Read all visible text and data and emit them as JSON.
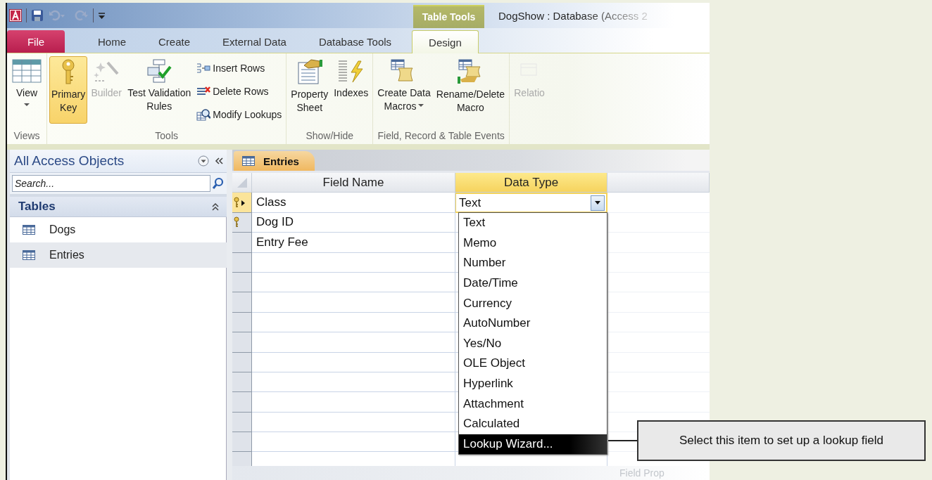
{
  "window": {
    "title": "DogShow : Database (Access 2"
  },
  "contextual_tab": {
    "label": "Table Tools"
  },
  "tabs": [
    {
      "label": "File",
      "kind": "backstage",
      "selected": false
    },
    {
      "label": "Home",
      "kind": "normal",
      "selected": false
    },
    {
      "label": "Create",
      "kind": "normal",
      "selected": false
    },
    {
      "label": "External Data",
      "kind": "normal",
      "selected": false
    },
    {
      "label": "Database Tools",
      "kind": "normal",
      "selected": false
    },
    {
      "label": "Design",
      "kind": "contextual",
      "selected": true
    }
  ],
  "ribbon": {
    "groups": [
      {
        "label": "Views",
        "commands": [
          {
            "label": "View",
            "kind": "large",
            "dropdown": true,
            "selected": false,
            "disabled": false
          }
        ]
      },
      {
        "label": "Tools",
        "commands": [
          {
            "label": "Primary\nKey",
            "kind": "large",
            "dropdown": false,
            "selected": true,
            "disabled": false
          },
          {
            "label": "Builder",
            "kind": "large",
            "dropdown": false,
            "selected": false,
            "disabled": true
          },
          {
            "label": "Test Validation\nRules",
            "kind": "large",
            "dropdown": false,
            "selected": false,
            "disabled": false
          },
          {
            "label": "Insert Rows",
            "kind": "small",
            "disabled": false
          },
          {
            "label": "Delete Rows",
            "kind": "small",
            "disabled": false
          },
          {
            "label": "Modify Lookups",
            "kind": "small",
            "disabled": false
          }
        ]
      },
      {
        "label": "Show/Hide",
        "commands": [
          {
            "label": "Property\nSheet",
            "kind": "large",
            "dropdown": false,
            "selected": false,
            "disabled": false
          },
          {
            "label": "Indexes",
            "kind": "large",
            "dropdown": false,
            "selected": false,
            "disabled": false
          }
        ]
      },
      {
        "label": "Field, Record & Table Events",
        "commands": [
          {
            "label": "Create Data\nMacros",
            "kind": "large",
            "dropdown": true,
            "selected": false,
            "disabled": false
          },
          {
            "label": "Rename/Delete\nMacro",
            "kind": "large",
            "dropdown": false,
            "selected": false,
            "disabled": false
          }
        ]
      },
      {
        "commands": [
          {
            "label": "Relatio",
            "kind": "large",
            "dropdown": false,
            "selected": false,
            "disabled": true
          }
        ]
      }
    ]
  },
  "navigation_pane": {
    "title": "All Access Objects",
    "search": {
      "placeholder": "Search..."
    },
    "sections": [
      {
        "label": "Tables",
        "expanded": true,
        "items": [
          {
            "label": "Dogs",
            "selected": false
          },
          {
            "label": "Entries",
            "selected": true
          }
        ]
      }
    ]
  },
  "document_tabs": [
    {
      "label": "Entries",
      "selected": true
    }
  ],
  "design_grid": {
    "columns": [
      {
        "label": "Field Name",
        "selected": false
      },
      {
        "label": "Data Type",
        "selected": true
      }
    ],
    "rows": [
      {
        "field_name": "Class",
        "data_type": "Text",
        "primary_key": true,
        "current": true
      },
      {
        "field_name": "Dog ID",
        "primary_key": true,
        "current": false
      },
      {
        "field_name": "Entry Fee",
        "primary_key": false,
        "current": false
      }
    ]
  },
  "data_type_dropdown": {
    "options": [
      {
        "label": "Text",
        "selected": false
      },
      {
        "label": "Memo",
        "selected": false
      },
      {
        "label": "Number",
        "selected": false
      },
      {
        "label": "Date/Time",
        "selected": false
      },
      {
        "label": "Currency",
        "selected": false
      },
      {
        "label": "AutoNumber",
        "selected": false
      },
      {
        "label": "Yes/No",
        "selected": false
      },
      {
        "label": "OLE Object",
        "selected": false
      },
      {
        "label": "Hyperlink",
        "selected": false
      },
      {
        "label": "Attachment",
        "selected": false
      },
      {
        "label": "Calculated",
        "selected": false
      },
      {
        "label": "Lookup Wizard...",
        "selected": true
      }
    ]
  },
  "field_properties": {
    "label": "Field Prop"
  },
  "callout": {
    "text": "Select this item to set up a lookup field"
  }
}
